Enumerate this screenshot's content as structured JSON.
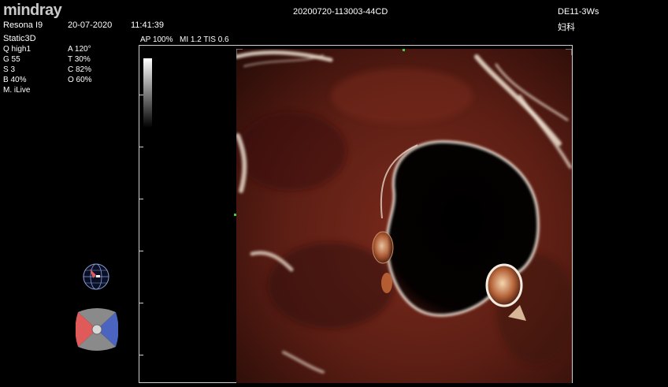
{
  "header": {
    "brand": "mindray",
    "model": "Resona I9",
    "date": "20-07-2020",
    "time": "11:41:39",
    "exam_id": "20200720-113003-44CD",
    "probe": "DE11-3Ws",
    "department": "妇科"
  },
  "mode": "Static3D",
  "safety": {
    "ap": "AP 100%",
    "mi_tis": "MI 1.2  TIS 0.6"
  },
  "params_left": [
    "Q high1",
    "G 55",
    "S 3",
    "B 40%",
    "M. iLive"
  ],
  "params_right": [
    "A 120°",
    "T 30%",
    "C 82%",
    "O 60%"
  ],
  "colors": {
    "tissue": "#5c1e14",
    "tissue_dark": "#2a0c08",
    "highlight": "#f2e6d6",
    "frame": "#cfcfcf",
    "marker": "#3fcf3f",
    "orient_red": "#e05a5a",
    "orient_blue": "#4a64c0"
  },
  "icons": {
    "orientation_sphere": "globe-icon",
    "orientation_disk": "orientation-disk-icon"
  }
}
